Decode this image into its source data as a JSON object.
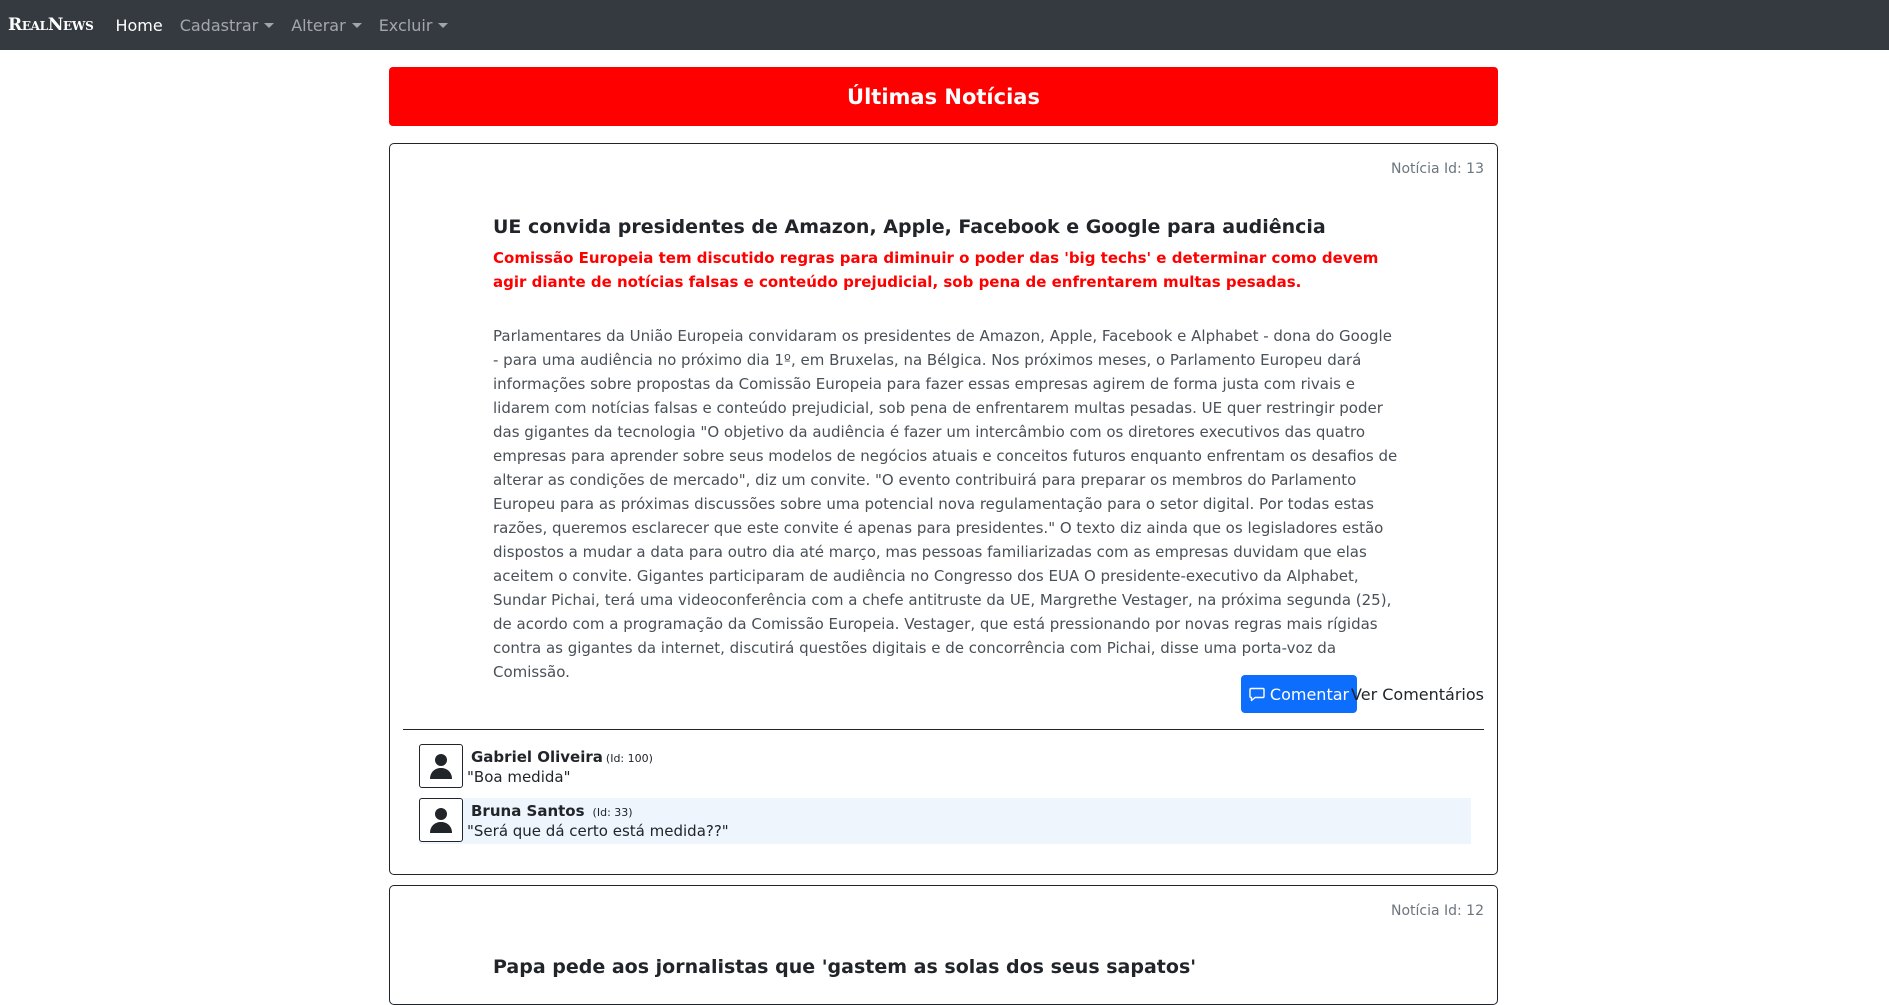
{
  "navbar": {
    "brand": "RealNews",
    "items": [
      {
        "label": "Home",
        "active": true,
        "dropdown": false
      },
      {
        "label": "Cadastrar",
        "active": false,
        "dropdown": true
      },
      {
        "label": "Alterar",
        "active": false,
        "dropdown": true
      },
      {
        "label": "Excluir",
        "active": false,
        "dropdown": true
      }
    ]
  },
  "banner": {
    "title": "Últimas Notícias",
    "color": "#ff0000"
  },
  "news": [
    {
      "id_label": "Notícia Id: 13",
      "title": "UE convida presidentes de Amazon, Apple, Facebook e Google para audiência",
      "subtitle": "Comissão Europeia tem discutido regras para diminuir o poder das 'big techs' e determinar como devem agir diante de notícias falsas e conteúdo prejudicial, sob pena de enfrentarem multas pesadas.",
      "body": "Parlamentares da União Europeia convidaram os presidentes de Amazon, Apple, Facebook e Alphabet - dona do Google - para uma audiência no próximo dia 1º, em Bruxelas, na Bélgica. Nos próximos meses, o Parlamento Europeu dará informações sobre propostas da Comissão Europeia para fazer essas empresas agirem de forma justa com rivais e lidarem com notícias falsas e conteúdo prejudicial, sob pena de enfrentarem multas pesadas. UE quer restringir poder das gigantes da tecnologia \"O objetivo da audiência é fazer um intercâmbio com os diretores executivos das quatro empresas para aprender sobre seus modelos de negócios atuais e conceitos futuros enquanto enfrentam os desafios de alterar as condições de mercado\", diz um convite. \"O evento contribuirá para preparar os membros do Parlamento Europeu para as próximas discussões sobre uma potencial nova regulamentação para o setor digital. Por todas estas razões, queremos esclarecer que este convite é apenas para presidentes.\" O texto diz ainda que os legisladores estão dispostos a mudar a data para outro dia até março, mas pessoas familiarizadas com as empresas duvidam que elas aceitem o convite. Gigantes participaram de audiência no Congresso dos EUA O presidente-executivo da Alphabet, Sundar Pichai, terá uma videoconferência com a chefe antitruste da UE, Margrethe Vestager, na próxima segunda (25), de acordo com a programação da Comissão Europeia. Vestager, que está pressionando por novas regras mais rígidas contra as gigantes da internet, discutirá questões digitais e de concorrência com Pichai, disse uma porta-voz da Comissão.",
      "comment_button": "Comentar",
      "view_comments": "Ver Comentários",
      "comments": [
        {
          "name": "Gabriel Oliveira",
          "id": "(Id: 100)",
          "text": "\"Boa medida\""
        },
        {
          "name": "Bruna Santos",
          "id": "(Id: 33)",
          "text": "\"Será que dá certo está medida??\""
        }
      ]
    },
    {
      "id_label": "Notícia Id: 12",
      "title": "Papa pede aos jornalistas que 'gastem as solas dos seus sapatos'"
    }
  ]
}
